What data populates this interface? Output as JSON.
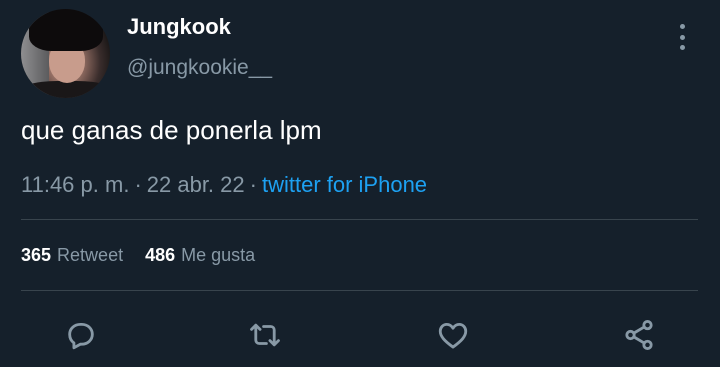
{
  "author": {
    "name": "Jungkook",
    "handle": "@jungkookie__"
  },
  "tweet": {
    "text": "que ganas de ponerla lpm",
    "time": "11:46 p. m.",
    "date": "22 abr. 22",
    "separator": "·",
    "client": "twitter for iPhone"
  },
  "stats": {
    "retweets_count": "365",
    "retweets_label": "Retweet",
    "likes_count": "486",
    "likes_label": "Me gusta"
  },
  "icons": {
    "more": "more-vertical-icon",
    "reply": "reply-icon",
    "retweet": "retweet-icon",
    "like": "heart-icon",
    "share": "share-icon"
  },
  "colors": {
    "background": "#15202b",
    "primary_text": "#ffffff",
    "secondary_text": "#8899a6",
    "link": "#1da1f2",
    "divider": "#38444d"
  }
}
